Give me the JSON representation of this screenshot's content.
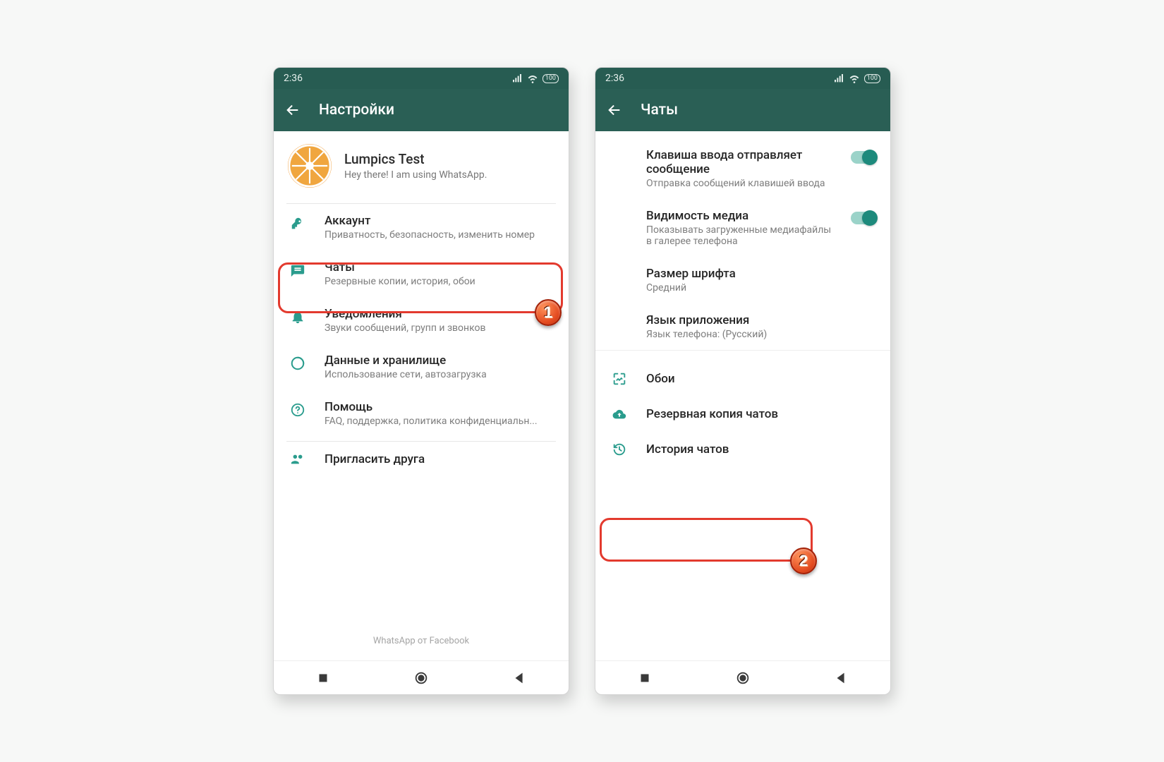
{
  "statusbar": {
    "time": "2:36",
    "battery": "100"
  },
  "screen1": {
    "header": {
      "title": "Настройки"
    },
    "profile": {
      "name": "Lumpics Test",
      "status": "Hey there! I am using WhatsApp."
    },
    "rows": {
      "account": {
        "title": "Аккаунт",
        "sub": "Приватность, безопасность, изменить номер"
      },
      "chats": {
        "title": "Чаты",
        "sub": "Резервные копии, история, обои"
      },
      "notif": {
        "title": "Уведомления",
        "sub": "Звуки сообщений, групп и звонков"
      },
      "data": {
        "title": "Данные и хранилище",
        "sub": "Использование сети, автозагрузка"
      },
      "help": {
        "title": "Помощь",
        "sub": "FAQ, поддержка, политика конфиденциальн..."
      },
      "invite": {
        "title": "Пригласить друга"
      }
    },
    "footer": "WhatsApp от Facebook",
    "badge": "1"
  },
  "screen2": {
    "header": {
      "title": "Чаты"
    },
    "rows": {
      "enter": {
        "title": "Клавиша ввода отправляет сообщение",
        "sub": "Отправка сообщений клавишей ввода"
      },
      "media": {
        "title": "Видимость медиа",
        "sub": "Показывать загруженные медиафайлы в галерее телефона"
      },
      "font": {
        "title": "Размер шрифта",
        "sub": "Средний"
      },
      "lang": {
        "title": "Язык приложения",
        "sub": "Язык телефона: (Русский)"
      },
      "wall": {
        "title": "Обои"
      },
      "backup": {
        "title": "Резервная копия чатов"
      },
      "hist": {
        "title": "История чатов"
      }
    },
    "badge": "2"
  }
}
